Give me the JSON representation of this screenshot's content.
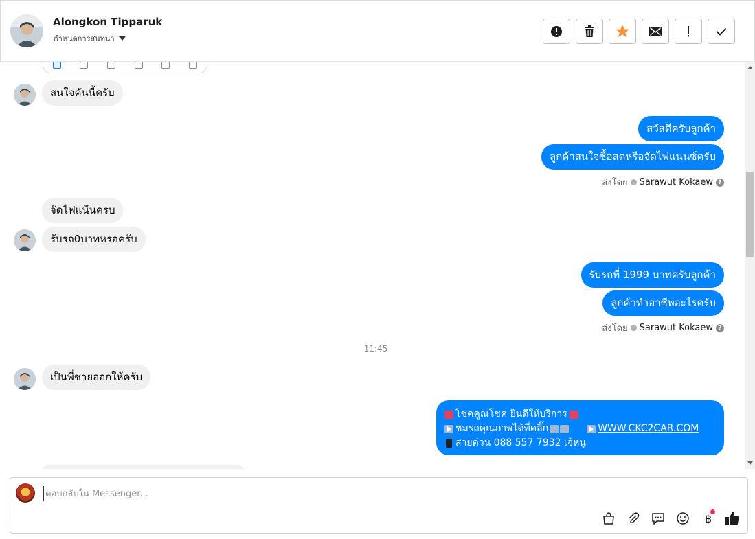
{
  "header": {
    "contact_name": "Alongkon Tipparuk",
    "sub_label": "กำหนดการสนทนา",
    "actions": [
      {
        "name": "report",
        "icon": "alert-circle-icon"
      },
      {
        "name": "delete",
        "icon": "trash-icon"
      },
      {
        "name": "star",
        "icon": "star-icon",
        "color": "#f7923b"
      },
      {
        "name": "mark-unread",
        "icon": "envelope-icon"
      },
      {
        "name": "important",
        "icon": "exclamation-icon"
      },
      {
        "name": "done",
        "icon": "checkmark-icon"
      }
    ]
  },
  "messages": {
    "in_1": "สนใจคันนี้ครับ",
    "out_1": "สวัสดีครับลูกค้า",
    "out_2": "ลูกค้าสนใจซื้อสดหรือจัดไฟแนนซ์ครับ",
    "sent_by_label": "ส่งโดย",
    "sent_by_name": "Sarawut Kokaew",
    "in_2": "จัดไฟแน้นครบ",
    "in_3": "รับรถ0บาทหรอครับ",
    "out_3": "รับรถที่ 1999 บาทครับลูกค้า",
    "out_4": "ลูกค้าทำอาชีพอะไรครับ",
    "timestamp": "11:45",
    "in_4": "เป็นพี่ชายออกให้ครับ",
    "promo": {
      "line1": "โชคคูณโชค ยินดีให้บริการ",
      "line2_text": "ชมรถคุณภาพได้ที่คลิ๊ก",
      "line2_link": "WWW.CKC2CAR.COM",
      "line3": "สายด่วน 088 557 7932 เจ้หนู"
    }
  },
  "composer": {
    "placeholder": "ตอบกลับใน Messenger...",
    "tools": [
      "bag-icon",
      "paperclip-icon",
      "saved-reply-icon",
      "emoji-icon",
      "baht-icon",
      "thumbs-up-icon"
    ]
  },
  "colors": {
    "outgoing_bubble": "#0084ff",
    "incoming_bubble": "#f0f0f0",
    "like": "#1c1e21"
  }
}
